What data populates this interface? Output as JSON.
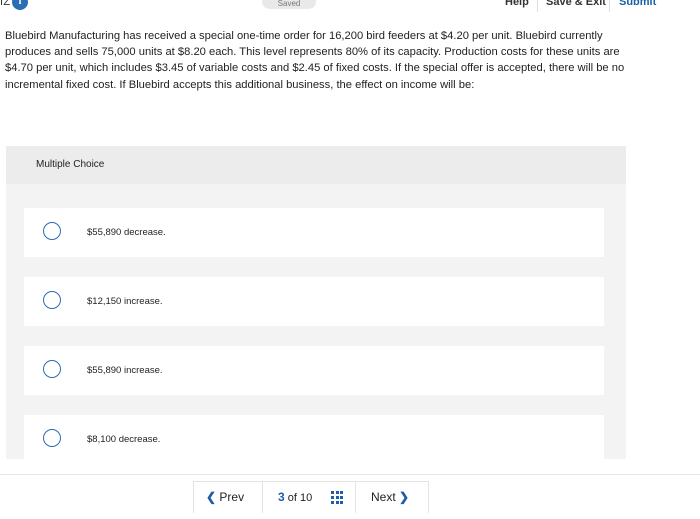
{
  "topbar": {
    "quiz_label": "IZ",
    "info_badge": "i",
    "saved_label": "Saved",
    "help_label": "Help",
    "save_exit_label": "Save & Exit",
    "submit_label": "Submit"
  },
  "question": {
    "text": "Bluebird Manufacturing has received a special one-time order for 16,200 bird feeders at $4.20 per unit. Bluebird currently produces and sells 75,000 units at $8.20 each. This level represents 80% of its capacity. Production costs for these units are $4.70 per unit, which includes $3.45 of variable costs and $2.45 of fixed costs. If the special offer is accepted, there will be no incremental fixed cost. If Bluebird accepts this additional business, the effect on income will be:"
  },
  "multiple_choice": {
    "title": "Multiple Choice",
    "options": [
      {
        "label": "$55,890 decrease."
      },
      {
        "label": "$12,150 increase."
      },
      {
        "label": "$55,890 increase."
      },
      {
        "label": "$8,100 decrease."
      }
    ]
  },
  "nav": {
    "prev_label": "Prev",
    "current_page": "3",
    "of_label": "of",
    "total_pages": "10",
    "next_label": "Next",
    "prev_icon": "chevron-left-icon",
    "next_icon": "chevron-right-icon",
    "grid_icon": "grid-icon"
  },
  "colors": {
    "accent": "#1b5fa7",
    "radio_border": "#2a6db5",
    "panel_bg": "#f3f3f3"
  }
}
